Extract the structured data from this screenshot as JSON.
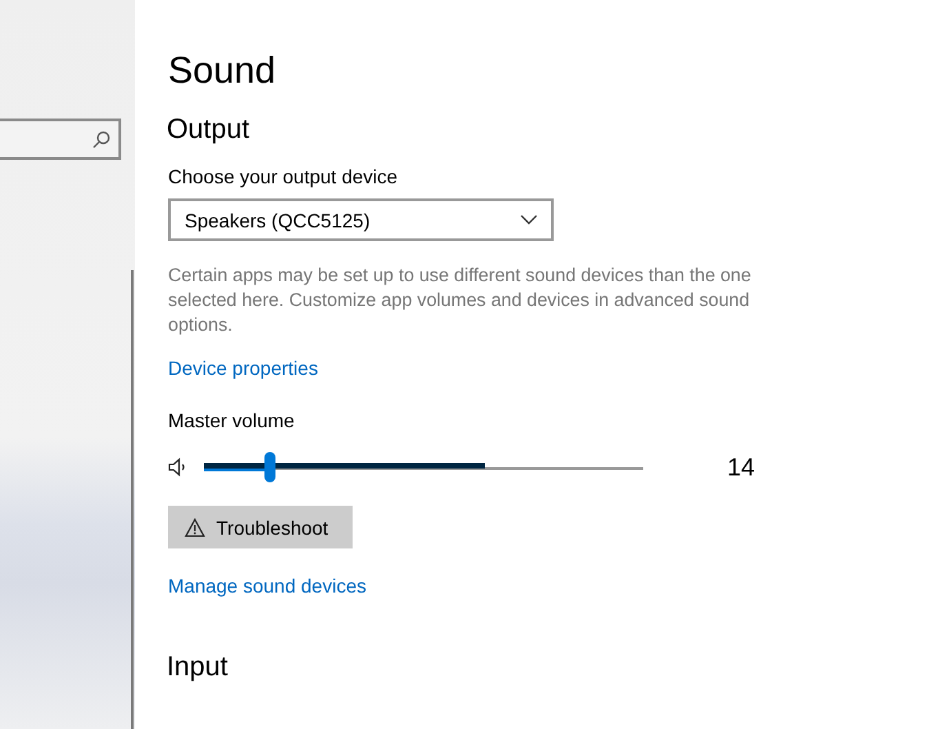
{
  "page": {
    "title": "Sound"
  },
  "output": {
    "heading": "Output",
    "device_label": "Choose your output device",
    "device": "Speakers (QCC5125)",
    "description": "Certain apps may be set up to use different sound devices than the one selected here. Customize app volumes and devices in advanced sound options.",
    "properties_link": "Device properties",
    "volume_label": "Master volume",
    "volume": {
      "level": 0.15,
      "reading": "14",
      "peak_meter": {
        "level": 0.64
      }
    },
    "troubleshoot_button": "Troubleshoot",
    "manage_link": "Manage sound devices"
  },
  "input": {
    "heading": "Input"
  }
}
